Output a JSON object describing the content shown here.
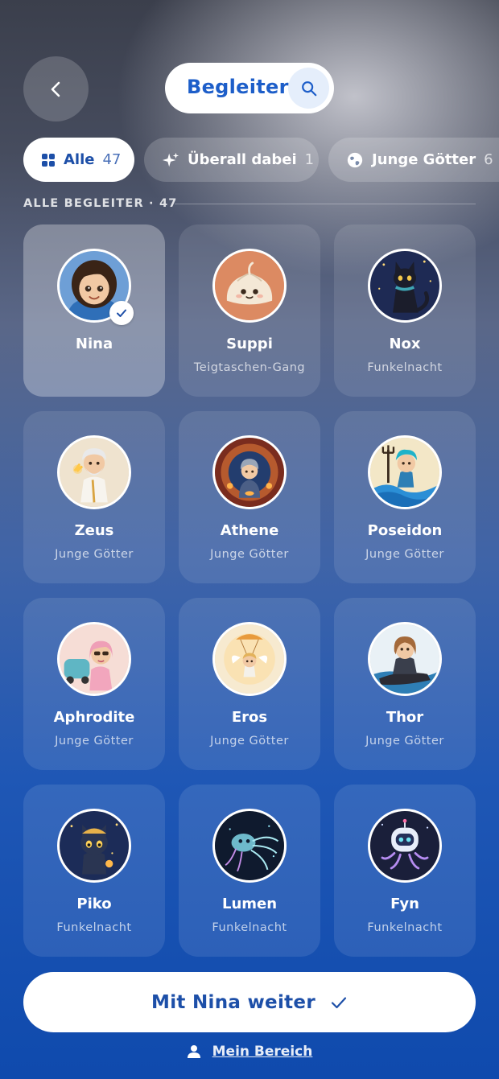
{
  "header": {
    "title": "Begleiter",
    "back_icon": "chevron-left-icon",
    "search_icon": "search-icon"
  },
  "filters": [
    {
      "label": "Alle",
      "count": "47",
      "icon": "grid-icon",
      "active": true
    },
    {
      "label": "Überall dabei",
      "count": "1",
      "icon": "sparkles-icon",
      "active": false
    },
    {
      "label": "Junge Götter",
      "count": "6",
      "icon": "globe-icon",
      "active": false
    }
  ],
  "section": {
    "label": "ALLE BEGLEITER · 47"
  },
  "companions": [
    {
      "name": "Nina",
      "group": "",
      "selected": true,
      "icon": "girl-avatar-icon"
    },
    {
      "name": "Suppi",
      "group": "Teigtaschen-Gang",
      "selected": false,
      "icon": "dumpling-avatar-icon"
    },
    {
      "name": "Nox",
      "group": "Funkelnacht",
      "selected": false,
      "icon": "cat-avatar-icon"
    },
    {
      "name": "Zeus",
      "group": "Junge Götter",
      "selected": false,
      "icon": "zeus-avatar-icon"
    },
    {
      "name": "Athene",
      "group": "Junge Götter",
      "selected": false,
      "icon": "athene-avatar-icon"
    },
    {
      "name": "Poseidon",
      "group": "Junge Götter",
      "selected": false,
      "icon": "poseidon-avatar-icon"
    },
    {
      "name": "Aphrodite",
      "group": "Junge Götter",
      "selected": false,
      "icon": "aphrodite-avatar-icon"
    },
    {
      "name": "Eros",
      "group": "Junge Götter",
      "selected": false,
      "icon": "eros-avatar-icon"
    },
    {
      "name": "Thor",
      "group": "Junge Götter",
      "selected": false,
      "icon": "thor-avatar-icon"
    },
    {
      "name": "Piko",
      "group": "Funkelnacht",
      "selected": false,
      "icon": "piko-avatar-icon"
    },
    {
      "name": "Lumen",
      "group": "Funkelnacht",
      "selected": false,
      "icon": "lumen-avatar-icon"
    },
    {
      "name": "Fyn",
      "group": "Funkelnacht",
      "selected": false,
      "icon": "fyn-avatar-icon"
    }
  ],
  "cta": {
    "label": "Mit Nina weiter",
    "icon": "check-icon"
  },
  "footer": {
    "label": "Mein Bereich",
    "icon": "person-icon"
  },
  "colors": {
    "accent": "#1d5ec9",
    "background_bottom": "#0f4aad"
  }
}
